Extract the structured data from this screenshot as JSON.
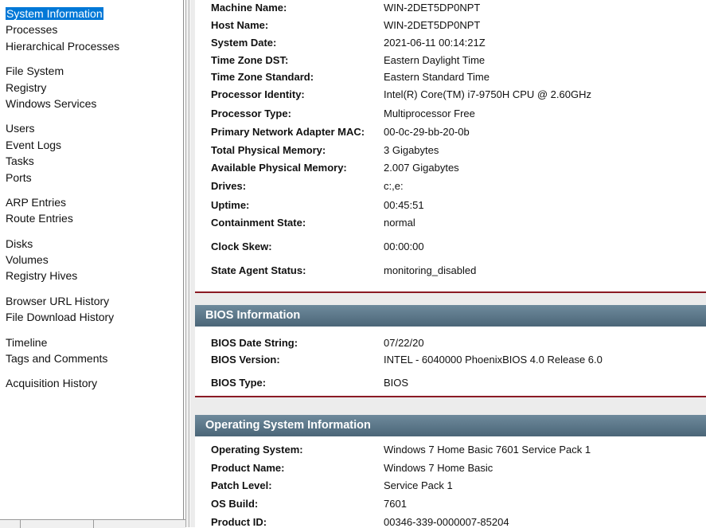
{
  "sidebar": {
    "groups": [
      {
        "items": [
          {
            "label": "System Information",
            "selected": true
          },
          {
            "label": "Processes"
          },
          {
            "label": "Hierarchical Processes"
          }
        ]
      },
      {
        "items": [
          {
            "label": "File System"
          },
          {
            "label": "Registry"
          },
          {
            "label": "Windows Services"
          }
        ]
      },
      {
        "items": [
          {
            "label": "Users"
          },
          {
            "label": "Event Logs"
          },
          {
            "label": "Tasks"
          },
          {
            "label": "Ports"
          }
        ]
      },
      {
        "items": [
          {
            "label": "ARP Entries"
          },
          {
            "label": "Route Entries"
          }
        ]
      },
      {
        "items": [
          {
            "label": "Disks"
          },
          {
            "label": "Volumes"
          },
          {
            "label": "Registry Hives"
          }
        ]
      },
      {
        "items": [
          {
            "label": "Browser URL History"
          },
          {
            "label": "File Download History"
          }
        ]
      },
      {
        "items": [
          {
            "label": "Timeline"
          },
          {
            "label": "Tags and Comments"
          }
        ]
      },
      {
        "items": [
          {
            "label": "Acquisition History"
          }
        ]
      }
    ]
  },
  "system": {
    "rows": [
      {
        "key": "Machine Name:",
        "value": "WIN-2DET5DP0NPT"
      },
      {
        "key": "Host Name:",
        "value": "WIN-2DET5DP0NPT"
      },
      {
        "key": "System Date:",
        "value": "2021-06-11 00:14:21Z"
      },
      {
        "key": "Time Zone DST:",
        "value": "Eastern Daylight Time"
      },
      {
        "key": "Time Zone Standard:",
        "value": "Eastern Standard Time"
      },
      {
        "key": "Processor Identity:",
        "value": "Intel(R) Core(TM) i7-9750H CPU @ 2.60GHz"
      },
      {
        "key": "Processor Type:",
        "value": "Multiprocessor Free"
      },
      {
        "key": "Primary Network Adapter MAC:",
        "value": "00-0c-29-bb-20-0b"
      },
      {
        "key": "Total Physical Memory:",
        "value": "3 Gigabytes"
      },
      {
        "key": "Available Physical Memory:",
        "value": "2.007 Gigabytes"
      },
      {
        "key": "Drives:",
        "value": "c:,e:"
      },
      {
        "key": "Uptime:",
        "value": "00:45:51"
      },
      {
        "key": "Containment State:",
        "value": "normal"
      },
      {
        "key": "Clock Skew:",
        "value": "00:00:00"
      },
      {
        "key": "State Agent Status:",
        "value": "monitoring_disabled"
      }
    ]
  },
  "bios": {
    "title": "BIOS Information",
    "rows": [
      {
        "key": "BIOS Date String:",
        "value": "07/22/20"
      },
      {
        "key": "BIOS Version:",
        "value": "INTEL  - 6040000 PhoenixBIOS 4.0 Release 6.0"
      },
      {
        "key": "BIOS Type:",
        "value": "BIOS"
      }
    ]
  },
  "os": {
    "title": "Operating System Information",
    "rows": [
      {
        "key": "Operating System:",
        "value": "Windows 7 Home Basic 7601 Service Pack 1"
      },
      {
        "key": "Product Name:",
        "value": "Windows 7 Home Basic"
      },
      {
        "key": "Patch Level:",
        "value": "Service Pack 1"
      },
      {
        "key": "OS Build:",
        "value": "7601"
      },
      {
        "key": "Product ID:",
        "value": "00346-339-0000007-85204"
      }
    ]
  },
  "colors": {
    "selection": "#0078d7",
    "section_header": "#5a7587",
    "section_rule": "#8b1a24"
  }
}
